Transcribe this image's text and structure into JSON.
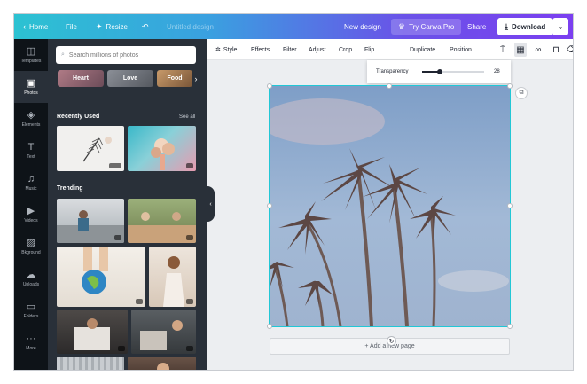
{
  "topbar": {
    "home": "Home",
    "file": "File",
    "resize": "Resize",
    "doc_title": "Untitled design",
    "new_design": "New design",
    "try_pro": "Try Canva Pro",
    "share": "Share",
    "download": "Download"
  },
  "rail": [
    {
      "label": "Templates",
      "icon": "template-icon",
      "glyph": "◫"
    },
    {
      "label": "Photos",
      "icon": "photo-icon",
      "glyph": "▣"
    },
    {
      "label": "Elements",
      "icon": "elements-icon",
      "glyph": "◈"
    },
    {
      "label": "Text",
      "icon": "text-icon",
      "glyph": "T"
    },
    {
      "label": "Music",
      "icon": "music-icon",
      "glyph": "♫"
    },
    {
      "label": "Videos",
      "icon": "video-icon",
      "glyph": "▶"
    },
    {
      "label": "Bkground",
      "icon": "background-icon",
      "glyph": "▨"
    },
    {
      "label": "Uploads",
      "icon": "upload-icon",
      "glyph": "☁"
    },
    {
      "label": "Folders",
      "icon": "folder-icon",
      "glyph": "▭"
    },
    {
      "label": "More",
      "icon": "more-icon",
      "glyph": "···"
    }
  ],
  "panel": {
    "search_placeholder": "Search millions of photos",
    "chips": [
      "Heart",
      "Love",
      "Food"
    ],
    "recently_used": "Recently Used",
    "see_all": "See all",
    "trending": "Trending"
  },
  "toolbar": {
    "style": "Style",
    "effects": "Effects",
    "filter": "Filter",
    "adjust": "Adjust",
    "crop": "Crop",
    "flip": "Flip",
    "duplicate": "Duplicate",
    "position": "Position"
  },
  "transparency": {
    "label": "Transparency",
    "value": "28",
    "fraction": 0.28
  },
  "canvas": {
    "add_page": "+ Add a new page"
  },
  "colors": {
    "accent": "#22c7d6",
    "panel": "#293039",
    "rail": "#0e1318"
  }
}
